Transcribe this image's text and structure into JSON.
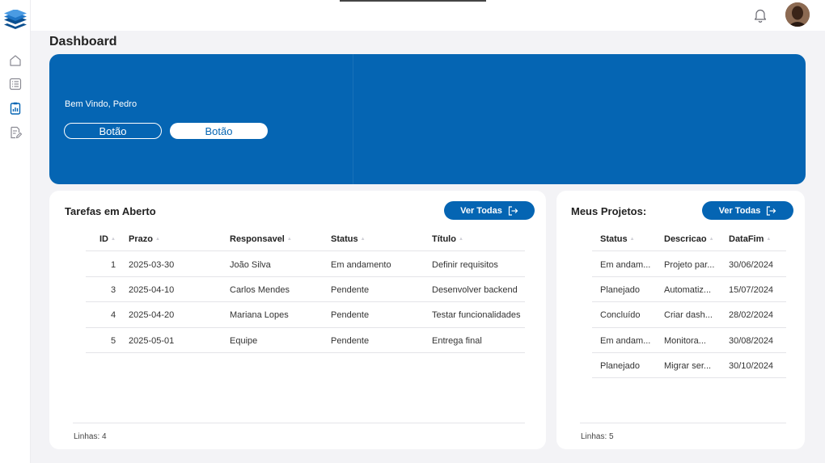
{
  "page": {
    "title": "Dashboard"
  },
  "hero": {
    "welcome": "Bem Vindo, Pedro",
    "button_outline": "Botão",
    "button_filled": "Botão"
  },
  "tasks": {
    "title": "Tarefas em Aberto",
    "see_all": "Ver Todas",
    "columns": [
      "ID",
      "Prazo",
      "Responsavel",
      "Status",
      "Título"
    ],
    "rows": [
      [
        "1",
        "2025-03-30",
        "João Silva",
        "Em andamento",
        "Definir requisitos"
      ],
      [
        "3",
        "2025-04-10",
        "Carlos Mendes",
        "Pendente",
        "Desenvolver backend"
      ],
      [
        "4",
        "2025-04-20",
        "Mariana Lopes",
        "Pendente",
        "Testar funcionalidades"
      ],
      [
        "5",
        "2025-05-01",
        "Equipe",
        "Pendente",
        "Entrega final"
      ]
    ],
    "footer": "Linhas: 4"
  },
  "projects": {
    "title": "Meus Projetos:",
    "see_all": "Ver Todas",
    "columns": [
      "Status",
      "Descricao",
      "DataFim"
    ],
    "rows": [
      [
        "Em andam...",
        "Projeto par...",
        "30/06/2024"
      ],
      [
        "Planejado",
        "Automatiz...",
        "15/07/2024"
      ],
      [
        "Concluído",
        "Criar dash...",
        "28/02/2024"
      ],
      [
        "Em andam...",
        "Monitora...",
        "30/08/2024"
      ],
      [
        "Planejado",
        "Migrar ser...",
        "30/10/2024"
      ]
    ],
    "footer": "Linhas: 5"
  },
  "icons": {
    "logo": "layers-logo-icon",
    "nav": [
      "home-icon",
      "list-icon",
      "report-icon",
      "edit-document-icon"
    ],
    "notifications": "bell-icon",
    "external": "exit-arrow-icon"
  },
  "colors": {
    "brand": "#0565b3",
    "background": "#f3f3f6",
    "card": "#ffffff",
    "nav_active": "#0565b3",
    "nav_inactive": "#8a8a93"
  }
}
